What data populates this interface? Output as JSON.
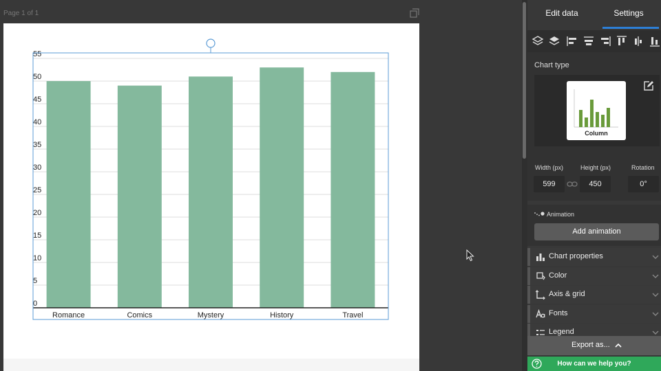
{
  "canvas": {
    "page_label": "Page 1 of 1"
  },
  "chart_data": {
    "type": "bar",
    "categories": [
      "Romance",
      "Comics",
      "Mystery",
      "History",
      "Travel"
    ],
    "values": [
      50,
      49,
      51,
      53,
      52
    ],
    "ylim": [
      0,
      55
    ],
    "yticks": [
      0,
      5,
      10,
      15,
      20,
      25,
      30,
      35,
      40,
      45,
      50,
      55
    ],
    "grid": true,
    "bar_color": "#84b99d"
  },
  "panel": {
    "tabs": {
      "edit_data": "Edit data",
      "settings": "Settings"
    },
    "accent_color": "#2d7fd6",
    "chart_type": {
      "label": "Chart type",
      "selected": "Column"
    },
    "dimensions": {
      "width_label": "Width (px)",
      "width_value": "599",
      "height_label": "Height (px)",
      "height_value": "450",
      "rotation_label": "Rotation",
      "rotation_value": "0°"
    },
    "animation": {
      "label": "Animation",
      "button": "Add animation"
    },
    "accordion": [
      {
        "label": "Chart properties",
        "icon": "bar-chart-icon"
      },
      {
        "label": "Color",
        "icon": "paint-bucket-icon"
      },
      {
        "label": "Axis & grid",
        "icon": "axis-icon"
      },
      {
        "label": "Fonts",
        "icon": "font-icon"
      },
      {
        "label": "Legend",
        "icon": "legend-icon"
      }
    ],
    "export": {
      "label": "Export as..."
    },
    "help": {
      "label": "How can we help you?",
      "color": "#2fa85a"
    }
  }
}
